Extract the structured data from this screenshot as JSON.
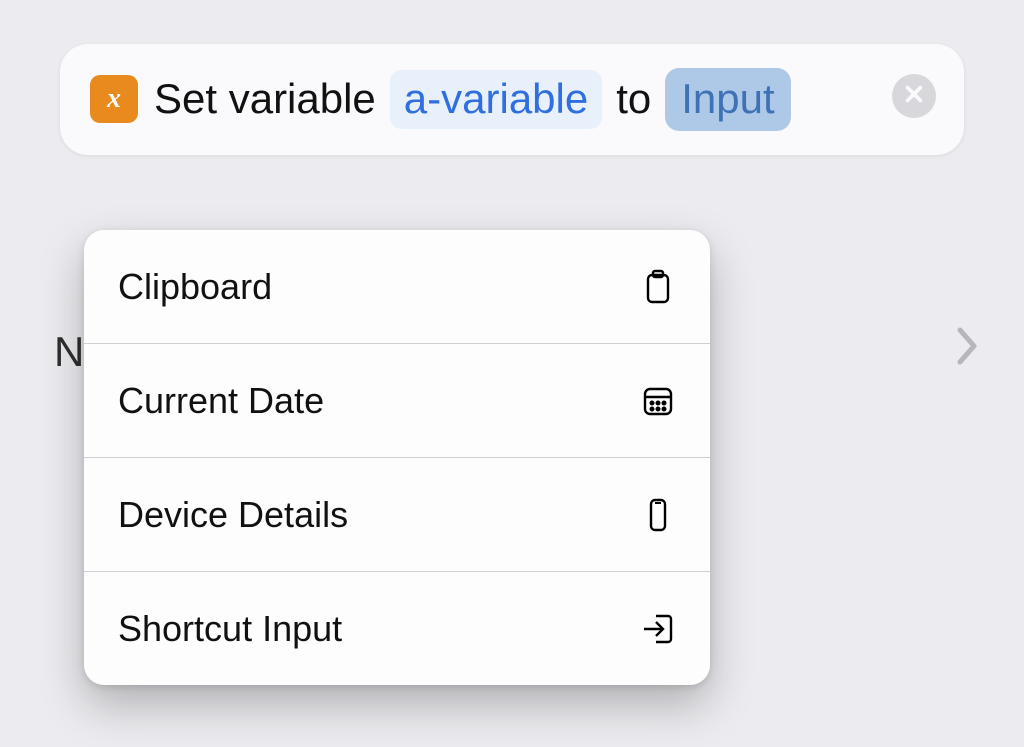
{
  "action": {
    "icon_glyph": "x",
    "text_prefix": "Set variable",
    "variable_name": "a-variable",
    "text_middle": "to",
    "value_token": "Input"
  },
  "background": {
    "left_peek": "N"
  },
  "menu": {
    "items": [
      {
        "label": "Clipboard",
        "icon": "clipboard-icon"
      },
      {
        "label": "Current Date",
        "icon": "calendar-icon"
      },
      {
        "label": "Device Details",
        "icon": "device-icon"
      },
      {
        "label": "Shortcut Input",
        "icon": "input-icon"
      }
    ]
  }
}
